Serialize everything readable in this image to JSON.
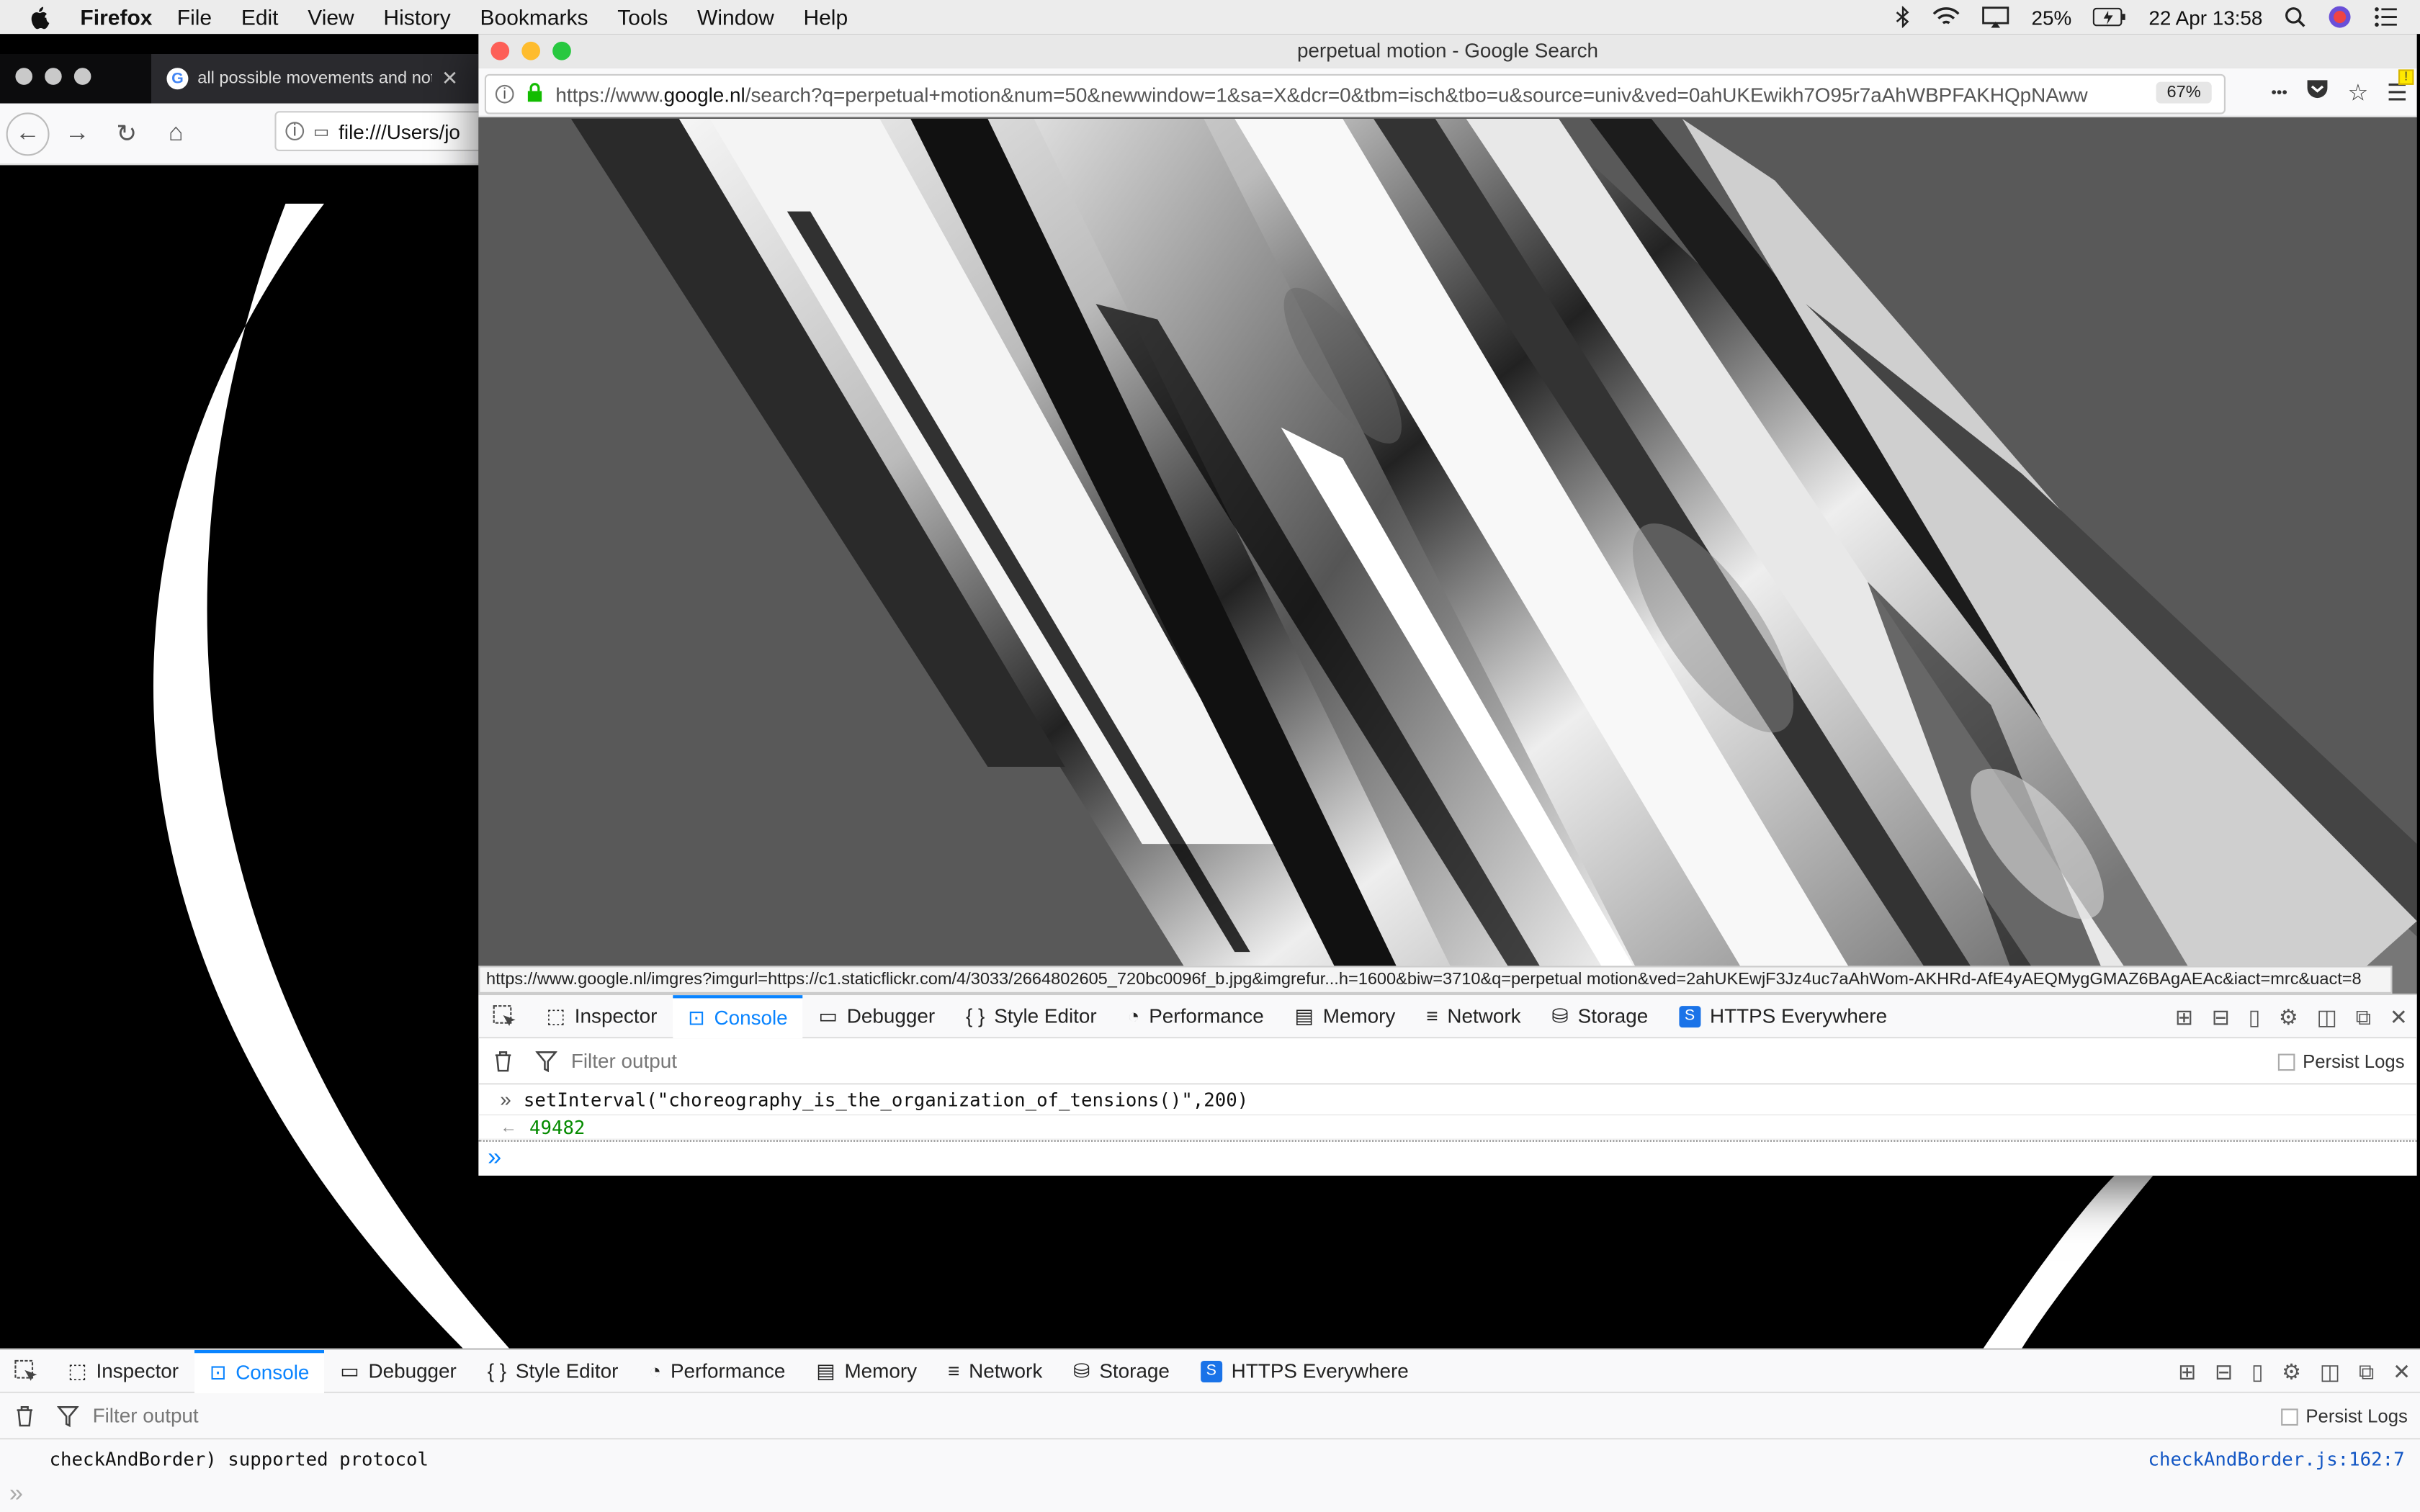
{
  "menubar": {
    "app_name": "Firefox",
    "items": [
      "File",
      "Edit",
      "View",
      "History",
      "Bookmarks",
      "Tools",
      "Window",
      "Help"
    ],
    "battery": "25%",
    "datetime": "22 Apr  13:58"
  },
  "back_window": {
    "tab_title": "all possible movements and not",
    "url": "file:///Users/jo",
    "devtools": {
      "tabs": [
        "Inspector",
        "Console",
        "Debugger",
        "Style Editor",
        "Performance",
        "Memory",
        "Network",
        "Storage",
        "HTTPS Everywhere"
      ],
      "active_tab": "Console",
      "filter_placeholder": "Filter output",
      "persist_label": "Persist Logs",
      "log_message": "checkAndBorder) supported protocol",
      "log_source": "checkAndBorder.js:162:7"
    }
  },
  "front_window": {
    "title": "perpetual motion - Google Search",
    "url_prefix": "https://www.",
    "url_domain": "google.nl",
    "url_rest": "/search?q=perpetual+motion&num=50&newwindow=1&sa=X&dcr=0&tbm=isch&tbo=u&source=univ&ved=0ahUKEwikh7O95r7aAhWBPFAKHQpNAww",
    "zoom": "67%",
    "status_url": "https://www.google.nl/imgres?imgurl=https://c1.staticflickr.com/4/3033/2664802605_720bc0096f_b.jpg&imgrefur...h=1600&biw=3710&q=perpetual motion&ved=2ahUKEwjF3Jz4uc7aAhWom-AKHRd-AfE4yAEQMygGMAZ6BAgAEAc&iact=mrc&uact=8",
    "devtools": {
      "tabs": [
        "Inspector",
        "Console",
        "Debugger",
        "Style Editor",
        "Performance",
        "Memory",
        "Network",
        "Storage",
        "HTTPS Everywhere"
      ],
      "active_tab": "Console",
      "filter_placeholder": "Filter output",
      "persist_label": "Persist Logs",
      "command": "setInterval(\"choreography_is_the_organization_of_tensions()\",200)",
      "result": "49482"
    }
  },
  "icons": {
    "close": "✕",
    "back": "←",
    "forward": "→",
    "reload": "↻",
    "home": "⌂",
    "more": "•••",
    "star": "☆",
    "menu": "☰",
    "trash": "🗑",
    "filter": "⛛",
    "prompt": "»",
    "result_arrow": "←"
  },
  "colors": {
    "accent": "#0a84ff",
    "result_green": "#058b00",
    "close_red": "#fd5f57",
    "minimize_yellow": "#febc2e",
    "maximize_green": "#28c840"
  }
}
